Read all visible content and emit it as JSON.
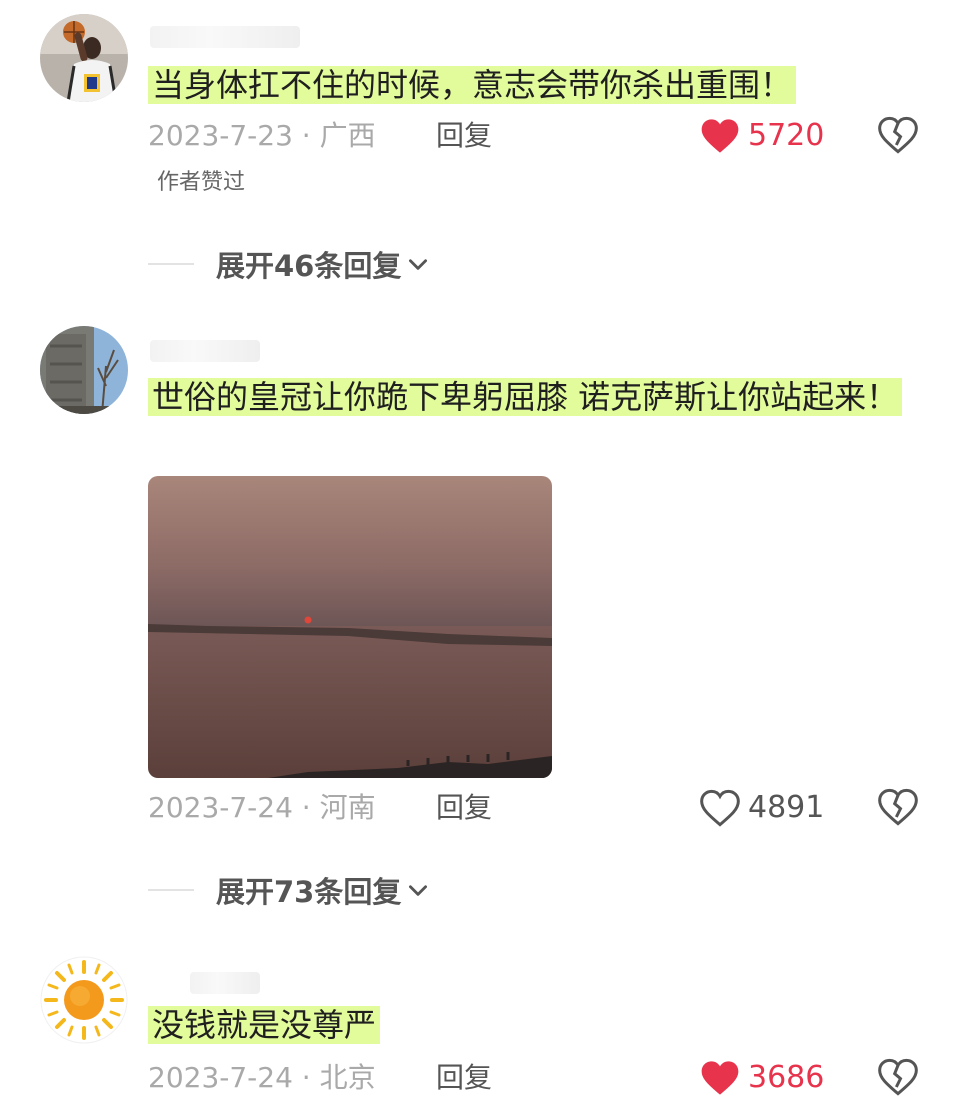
{
  "comments": [
    {
      "avatar_icon": "basketball-player-avatar",
      "text": "当身体扛不住的时候，意志会带你杀出重围！",
      "date_location": "2023-7-23 · 广西",
      "reply_label": "回复",
      "like_count": "5720",
      "liked": true,
      "badge": "作者赞过",
      "expand_label": "展开46条回复"
    },
    {
      "avatar_icon": "building-tree-avatar",
      "text": "世俗的皇冠让你跪下卑躬屈膝 诺克萨斯让你站起来！",
      "date_location": "2023-7-24 · 河南",
      "reply_label": "回复",
      "like_count": "4891",
      "liked": false,
      "expand_label": "展开73条回复"
    },
    {
      "avatar_icon": "sun-avatar",
      "text": "没钱就是没尊严",
      "date_location": "2023-7-24 · 北京",
      "reply_label": "回复",
      "like_count": "3686",
      "liked": true
    }
  ],
  "colors": {
    "highlight": "#e2fb9b",
    "like_red": "#e8334d",
    "meta_grey": "#a9a9a9"
  }
}
